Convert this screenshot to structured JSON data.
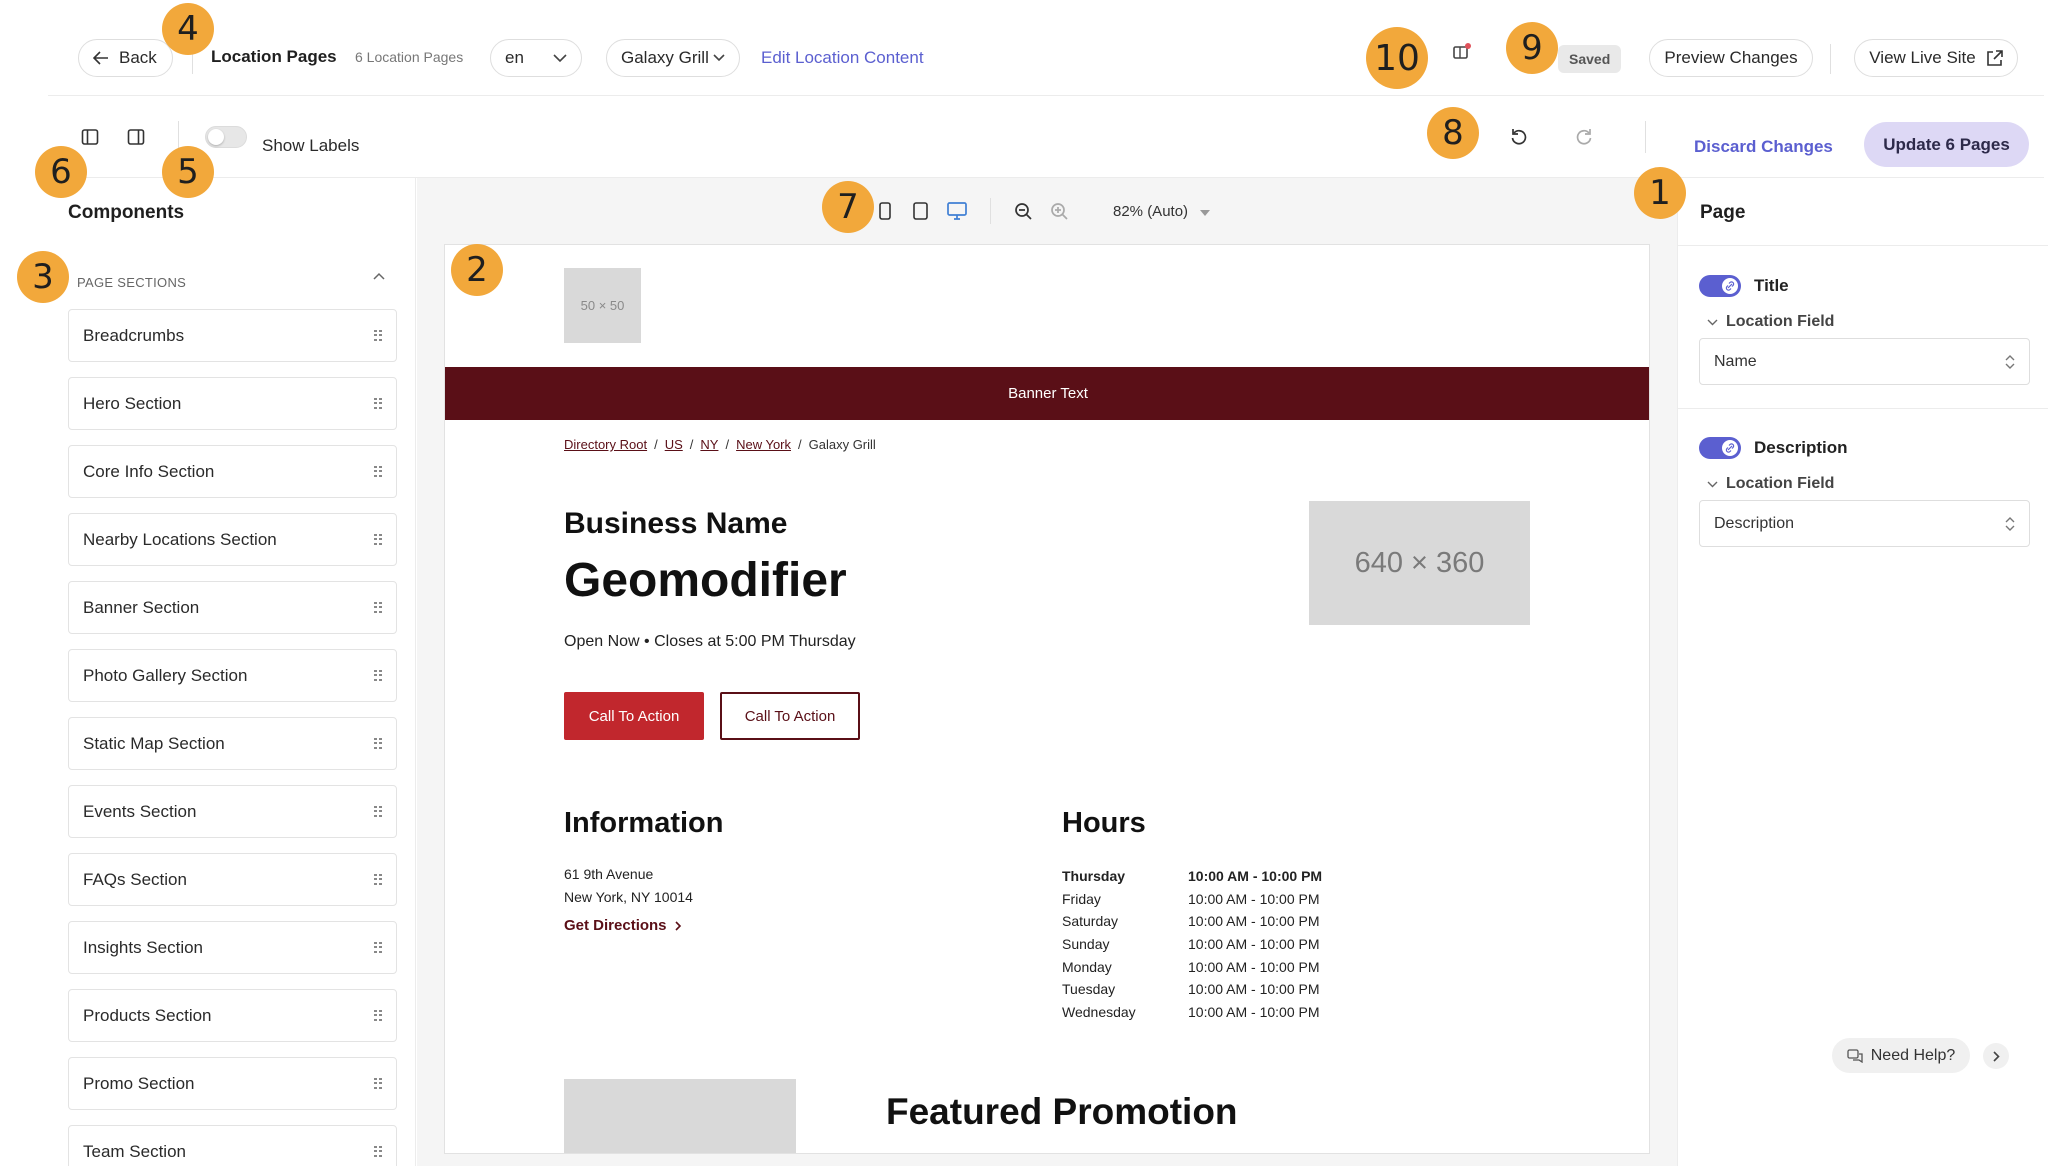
{
  "header": {
    "back_label": "Back",
    "title": "Location Pages",
    "count": "6 Location Pages",
    "language": "en",
    "location": "Galaxy Grill",
    "edit_link": "Edit Location Content",
    "saved_badge": "Saved",
    "preview_button": "Preview Changes",
    "live_button": "View Live Site"
  },
  "toolbar": {
    "show_labels": "Show Labels",
    "discard": "Discard Changes",
    "update": "Update 6 Pages"
  },
  "left_panel": {
    "title": "Components",
    "section_header": "PAGE SECTIONS",
    "items": [
      "Breadcrumbs",
      "Hero Section",
      "Core Info Section",
      "Nearby Locations Section",
      "Banner Section",
      "Photo Gallery Section",
      "Static Map Section",
      "Events Section",
      "FAQs Section",
      "Insights Section",
      "Products Section",
      "Promo Section",
      "Team Section"
    ]
  },
  "canvas": {
    "zoom": "82% (Auto)"
  },
  "preview": {
    "logo_placeholder": "50 × 50",
    "banner_text": "Banner Text",
    "breadcrumbs": [
      "Directory Root",
      "US",
      "NY",
      "New York"
    ],
    "breadcrumb_current": "Galaxy Grill",
    "business_name": "Business Name",
    "geomodifier": "Geomodifier",
    "open_status": "Open Now • Closes at 5:00 PM Thursday",
    "cta_primary": "Call To Action",
    "cta_secondary": "Call To Action",
    "hero_placeholder": "640 × 360",
    "info_heading": "Information",
    "address_line1": "61 9th Avenue",
    "address_line2": "New York, NY 10014",
    "directions": "Get Directions",
    "hours_heading": "Hours",
    "hours": [
      {
        "day": "Thursday",
        "time": "10:00 AM - 10:00 PM"
      },
      {
        "day": "Friday",
        "time": "10:00 AM - 10:00 PM"
      },
      {
        "day": "Saturday",
        "time": "10:00 AM - 10:00 PM"
      },
      {
        "day": "Sunday",
        "time": "10:00 AM - 10:00 PM"
      },
      {
        "day": "Monday",
        "time": "10:00 AM - 10:00 PM"
      },
      {
        "day": "Tuesday",
        "time": "10:00 AM - 10:00 PM"
      },
      {
        "day": "Wednesday",
        "time": "10:00 AM - 10:00 PM"
      }
    ],
    "promo_heading": "Featured Promotion"
  },
  "right_panel": {
    "title": "Page",
    "fields": [
      {
        "label": "Title",
        "sub_label": "Location Field",
        "value": "Name"
      },
      {
        "label": "Description",
        "sub_label": "Location Field",
        "value": "Description"
      }
    ],
    "help": "Need Help?"
  },
  "markers": [
    "1",
    "2",
    "3",
    "4",
    "5",
    "6",
    "7",
    "8",
    "9",
    "10"
  ],
  "colors": {
    "accent": "#5b5fd0",
    "brand_dark": "#5a0f17",
    "cta_red": "#c1272d",
    "marker": "#f2a83b"
  }
}
